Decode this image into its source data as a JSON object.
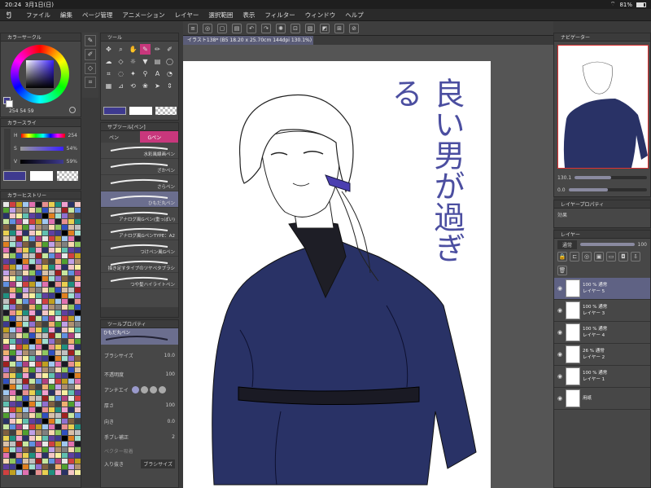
{
  "status": {
    "time": "20:24",
    "date": "3月1日(日)",
    "battery": "81%"
  },
  "menu": [
    "ファイル",
    "編集",
    "ページ管理",
    "アニメーション",
    "レイヤー",
    "選択範囲",
    "表示",
    "フィルター",
    "ウィンドウ",
    "ヘルプ"
  ],
  "panels": {
    "color_circle": "カラーサークル",
    "color_slider": "カラースライ",
    "color_history": "カラーヒストリー",
    "tool": "ツール",
    "subtool": "サブツール[ペン]",
    "tool_property": "ツールプロパティ",
    "navigator": "ナビゲーター",
    "layer_property": "レイヤープロパティ",
    "layer": "レイヤー"
  },
  "color": {
    "b_value": "254",
    "g_value": "54",
    "r_value": "59",
    "h_label": "H",
    "s_label": "S",
    "v_label": "V",
    "h_value": "254",
    "s_value": "54%",
    "v_value": "59%",
    "main_color": "#3e3a8f"
  },
  "subtool": {
    "tabs": [
      "ペン",
      "Gペン"
    ],
    "brushes": [
      "水彩風線画ペン",
      "ざかペン",
      "さらペン",
      "ひもだ丸ペン",
      "アナログ風Gペン(重っぽい)",
      "アナログ風GペンTYPE：A2",
      "つけペン風Gペン",
      "描き足すタイプのツヤベタブラシ",
      "つや髪ハイライトペン"
    ],
    "selected_index": 3
  },
  "tool_property": {
    "brush_name": "ひもだ丸ペン",
    "brush_size_label": "ブラシサイズ",
    "brush_size": "10.0",
    "opacity_label": "不透明度",
    "opacity": "100",
    "antialias_label": "アンチエイ",
    "thickness_label": "厚さ",
    "thickness": "100",
    "direction_label": "向き",
    "direction": "0.0",
    "stabilize_label": "手ブレ補正",
    "stabilize": "2",
    "vector_label": "ベクター吸着",
    "inout_label": "入り抜き",
    "inout_value": "ブラシサイズ"
  },
  "canvas_tab": "イラスト138* (B5 18.20 x 25.70cm 144dpi 130.1%)",
  "navigator": {
    "zoom": "130.1",
    "rotate": "0.0"
  },
  "layer_property": {
    "effect_label": "効果"
  },
  "layers_panel": {
    "blend": "通常",
    "opacity": "100"
  },
  "layers": [
    {
      "opacity": "100 %",
      "mode": "通常",
      "name": "レイヤー 5",
      "selected": true
    },
    {
      "opacity": "100 %",
      "mode": "通常",
      "name": "レイヤー 3",
      "selected": false
    },
    {
      "opacity": "100 %",
      "mode": "通常",
      "name": "レイヤー 4",
      "selected": false
    },
    {
      "opacity": "26 %",
      "mode": "通常",
      "name": "レイヤー 2",
      "selected": false
    },
    {
      "opacity": "100 %",
      "mode": "通常",
      "name": "レイヤー 1",
      "selected": false
    },
    {
      "opacity": "",
      "mode": "",
      "name": "用紙",
      "selected": false
    }
  ],
  "artwork_text": [
    "良い男が過ぎる"
  ]
}
